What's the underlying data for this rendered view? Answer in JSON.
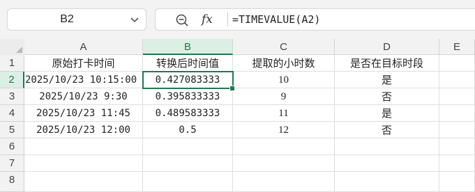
{
  "name_box": {
    "value": "B2"
  },
  "formula_bar": {
    "formula": "=TIMEVALUE(A2)",
    "fx_label": "fx"
  },
  "columns": [
    "A",
    "B",
    "C",
    "D",
    "E"
  ],
  "rows": [
    "1",
    "2",
    "3",
    "4",
    "5",
    "6",
    "7",
    "8"
  ],
  "selected_cell": "B2",
  "sheet": {
    "headers": [
      "原始打卡时间",
      "转换后时间值",
      "提取的小时数",
      "是否在目标时段"
    ],
    "data": [
      [
        "2025/10/23 10:15:00",
        "0.427083333",
        "10",
        "是"
      ],
      [
        "2025/10/23 9:30",
        "0.395833333",
        "9",
        "否"
      ],
      [
        "2025/10/23 11:45",
        "0.489583333",
        "11",
        "是"
      ],
      [
        "2025/10/23 12:00",
        "0.5",
        "12",
        "否"
      ]
    ]
  },
  "colors": {
    "accent": "#1d7a4a",
    "header_bg": "#f2f2f2",
    "selected_header_bg": "#dcefe4"
  }
}
